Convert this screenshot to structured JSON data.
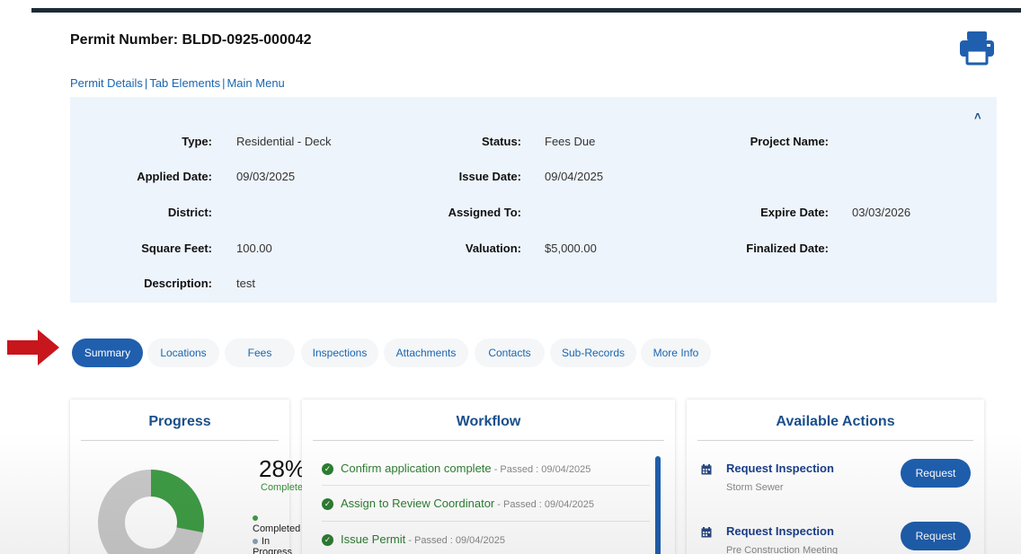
{
  "header": {
    "permit_title": "Permit Number: BLDD-0925-000042"
  },
  "links": [
    "Permit Details",
    "Tab Elements",
    "Main Menu"
  ],
  "details": {
    "type_label": "Type:",
    "type_value": "Residential - Deck",
    "status_label": "Status:",
    "status_value": "Fees Due",
    "project_label": "Project Name:",
    "project_value": "",
    "applied_label": "Applied Date:",
    "applied_value": "09/03/2025",
    "issue_label": "Issue Date:",
    "issue_value": "09/04/2025",
    "district_label": "District:",
    "district_value": "",
    "assigned_label": "Assigned To:",
    "assigned_value": "",
    "expire_label": "Expire Date:",
    "expire_value": "03/03/2026",
    "sqft_label": "Square Feet:",
    "sqft_value": "100.00",
    "valuation_label": "Valuation:",
    "valuation_value": "$5,000.00",
    "finalized_label": "Finalized Date:",
    "finalized_value": "",
    "description_label": "Description:",
    "description_value": "test"
  },
  "tabs": [
    "Summary",
    "Locations",
    "Fees",
    "Inspections",
    "Attachments",
    "Contacts",
    "Sub-Records",
    "More Info"
  ],
  "progress": {
    "title": "Progress",
    "percent_text": "28%",
    "percent_value": 28,
    "sub": "Completed",
    "legend": [
      {
        "label": "Completed",
        "color": "#3f9c45"
      },
      {
        "label": "In Progress",
        "color": "#8aa3b6"
      }
    ]
  },
  "workflow": {
    "title": "Workflow",
    "items": [
      {
        "name": "Confirm application complete",
        "meta": " - Passed : 09/04/2025"
      },
      {
        "name": "Assign to Review Coordinator",
        "meta": " - Passed : 09/04/2025"
      },
      {
        "name": "Issue Permit",
        "meta": " - Passed : 09/04/2025"
      }
    ]
  },
  "actions": {
    "title": "Available Actions",
    "items": [
      {
        "title": "Request Inspection",
        "sub": "Storm Sewer",
        "button": "Request"
      },
      {
        "title": "Request Inspection",
        "sub": "Pre Construction Meeting",
        "button": "Request"
      }
    ]
  },
  "colors": {
    "accent": "#1f5fae",
    "completed": "#3f9c45",
    "link": "#1a66b0",
    "arrow": "#c8161d"
  }
}
